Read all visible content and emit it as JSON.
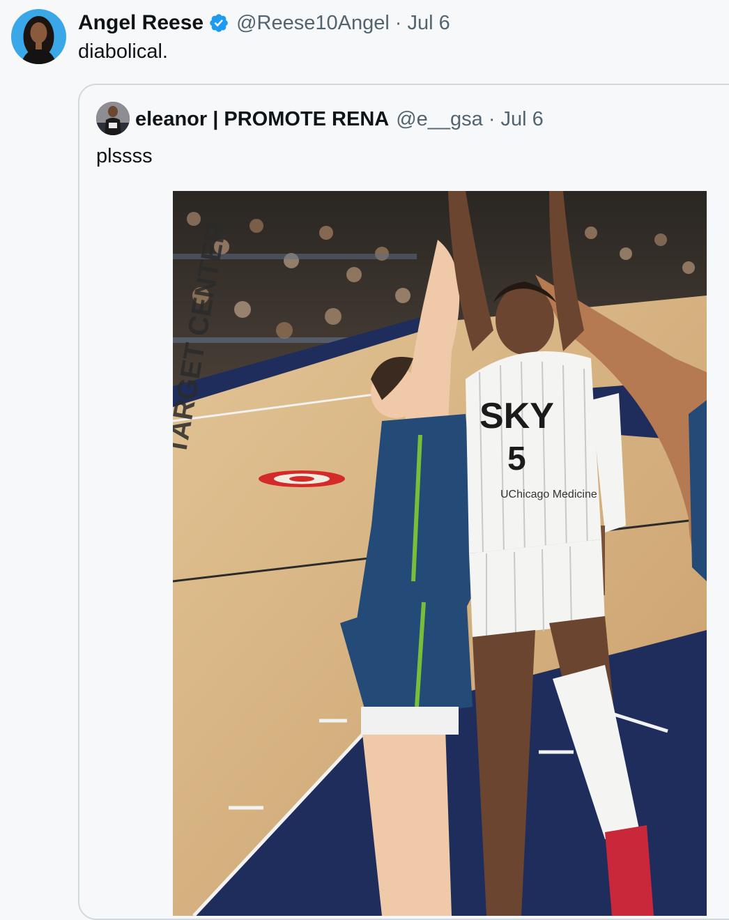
{
  "tweet": {
    "author_name": "Angel Reese",
    "author_handle": "@Reese10Angel",
    "separator": "·",
    "date": "Jul 6",
    "text": "diabolical.",
    "avatar_icon": "profile-photo",
    "verified_icon": "verified-badge-icon",
    "verified_color": "#1d9bf0"
  },
  "quoted": {
    "author_name": "eleanor | PROMOTE RENA",
    "author_handle": "@e__gsa",
    "separator": "·",
    "date": "Jul 6",
    "text": "plssss",
    "avatar_icon": "profile-photo",
    "media": {
      "jersey_wordmark": "SKY",
      "jersey_number": "5",
      "jersey_sponsor": "UChicago Medicine",
      "floor_text": "TARGET CENTER",
      "colors": {
        "court_wood": "#d9b98a",
        "court_paint": "#1f2d5c",
        "lynx_jersey": "#244a78",
        "lynx_trim": "#78be3a",
        "sky_jersey": "#f4f4f2",
        "target_red": "#d42a2a"
      }
    }
  }
}
